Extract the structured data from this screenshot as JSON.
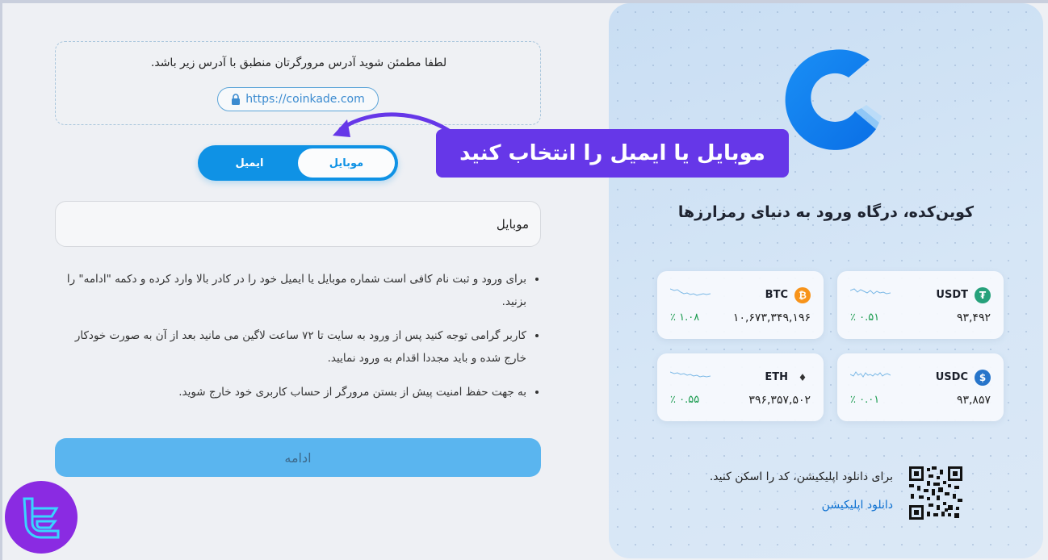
{
  "url_notice": {
    "text": "لطفا مطمئن شوید آدرس مرورگرتان منطبق با آدرس زیر باشد.",
    "url": "https://coinkade.com"
  },
  "tabs": {
    "mobile_label": "موبایل",
    "email_label": "ایمیل",
    "selected": "mobile"
  },
  "callout": {
    "text": "موبایل یا ایمیل را انتخاب کنید"
  },
  "form": {
    "phone_placeholder": "موبایل",
    "rules": [
      "برای ورود و ثبت نام کافی است شماره موبایل یا ایمیل خود را در کادر بالا وارد کرده و دکمه \"ادامه\" را بزنید.",
      "کاربر گرامی توجه کنید پس از ورود به سایت تا ۷۲ ساعت لاگین می مانید بعد از آن به صورت خودکار خارج شده و باید مجددا اقدام به ورود نمایید.",
      "به جهت حفظ امنیت پیش از بستن مرورگر از حساب کاربری خود خارج شوید."
    ],
    "continue_label": "ادامه"
  },
  "promo": {
    "title": "کوین‌کده، درگاه ورود به دنیای رمزارزها",
    "tickers": [
      {
        "symbol": "USDT",
        "price": "۹۳,۴۹۲",
        "change": "٪ ۰.۵۱",
        "icon": "tether-icon",
        "icon_color": "#26a17b",
        "icon_glyph": "₮"
      },
      {
        "symbol": "BTC",
        "price": "۱۰,۶۷۳,۳۴۹,۱۹۶",
        "change": "٪ ۱.۰۸",
        "icon": "bitcoin-icon",
        "icon_color": "#f7931a",
        "icon_glyph": "₿"
      },
      {
        "symbol": "USDC",
        "price": "۹۳,۸۵۷",
        "change": "٪ ۰.۰۱",
        "icon": "usdc-icon",
        "icon_color": "#2775ca",
        "icon_glyph": "$"
      },
      {
        "symbol": "ETH",
        "price": "۳۹۶,۳۵۷,۵۰۲",
        "change": "٪ ۰.۵۵",
        "icon": "ethereum-icon",
        "icon_color": "#333333",
        "icon_glyph": "♦"
      }
    ],
    "qr_text": "برای دانلود اپلیکیشن، کد را اسکن کنید.",
    "download_link": "دانلود اپلیکیشن"
  },
  "colors": {
    "accent": "#0f92e5",
    "callout": "#6637e8",
    "continue_button": "#5ab5ef",
    "positive_change": "#1a9b4e"
  }
}
